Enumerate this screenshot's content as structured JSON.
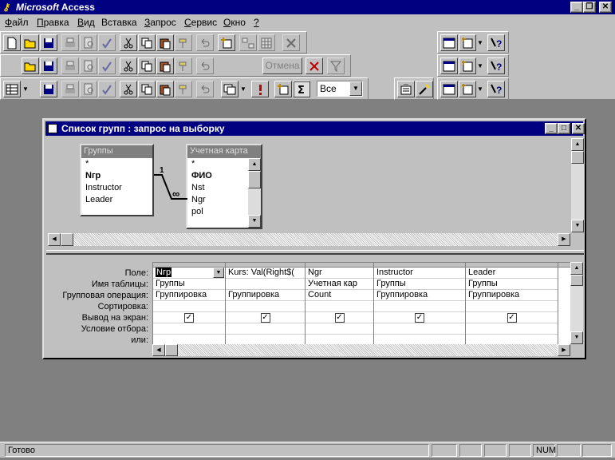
{
  "app": {
    "title_brand": "Microsoft",
    "title_rest": "Access"
  },
  "menu": {
    "items": [
      {
        "label": "Файл",
        "hotkey": "Ф",
        "rest": "айл"
      },
      {
        "label": "Правка",
        "hotkey": "П",
        "rest": "равка"
      },
      {
        "label": "Вид",
        "hotkey": "В",
        "rest": "ид"
      },
      {
        "label": "Вставка",
        "hotkey": "",
        "rest": "Вставка"
      },
      {
        "label": "Запрос",
        "hotkey": "З",
        "rest": "апрос"
      },
      {
        "label": "Сервис",
        "hotkey": "С",
        "rest": "ервис"
      },
      {
        "label": "Окно",
        "hotkey": "О",
        "rest": "кно"
      },
      {
        "label": "?",
        "hotkey": "?",
        "rest": ""
      }
    ]
  },
  "toolbar2": {
    "cancel_label": "Отмена"
  },
  "toolbar3": {
    "view_combo_value": "Все"
  },
  "query_window": {
    "title": "Список групп : запрос на выборку",
    "tables": [
      {
        "name": "Группы",
        "fields": [
          "*",
          "Nгр",
          "Instructor",
          "Leader"
        ]
      },
      {
        "name": "Учетная карта",
        "fields": [
          "*",
          "ФИО",
          "Nst",
          "Ngr",
          "pol"
        ]
      }
    ],
    "join": {
      "one_side": "1",
      "many_side": "∞"
    },
    "row_labels": [
      "Поле:",
      "Имя таблицы:",
      "Групповая операция:",
      "Сортировка:",
      "Вывод на экран:",
      "Условие отбора:",
      "или:"
    ],
    "columns": [
      {
        "field": "Nгр",
        "table": "Группы",
        "total": "Группировка",
        "sort": "",
        "show": true
      },
      {
        "field": "Kurs: Val(Right$(",
        "table": "",
        "total": "Группировка",
        "sort": "",
        "show": true
      },
      {
        "field": "Ngr",
        "table": "Учетная кар",
        "total": "Count",
        "sort": "",
        "show": true
      },
      {
        "field": "Instructor",
        "table": "Группы",
        "total": "Группировка",
        "sort": "",
        "show": true
      },
      {
        "field": "Leader",
        "table": "Группы",
        "total": "Группировка",
        "sort": "",
        "show": true
      }
    ]
  },
  "status": {
    "text": "Готово",
    "num": "NUM"
  }
}
